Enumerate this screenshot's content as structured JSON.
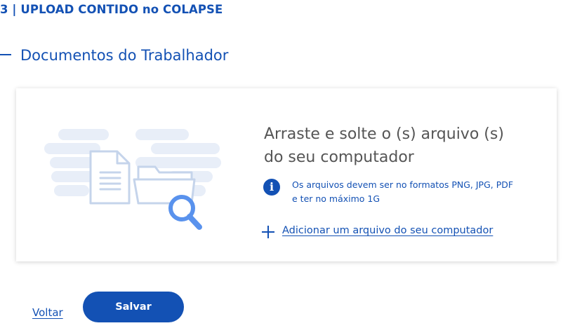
{
  "step": {
    "title": "3 | UPLOAD CONTIDO no COLAPSE"
  },
  "section": {
    "title": "Documentos do Trabalhador",
    "icon": "collapse-minus-icon"
  },
  "upload": {
    "drop_text_line1": "Arraste e solte o (s) arquivo (s)",
    "drop_text_line2": "do seu computador",
    "info_text": "Os arquivos devem ser no formatos PNG, JPG, PDF e ter no máximo 1G",
    "info_icon_glyph": "i",
    "add_link_label": "Adicionar um arquivo do seu computador",
    "illustration": "documents-folder-search-illustration"
  },
  "actions": {
    "back_label": "Voltar",
    "save_label": "Salvar"
  },
  "colors": {
    "primary": "#1351b4",
    "illustration_light": "#c5d4eb",
    "illustration_accent": "#5992ed"
  }
}
